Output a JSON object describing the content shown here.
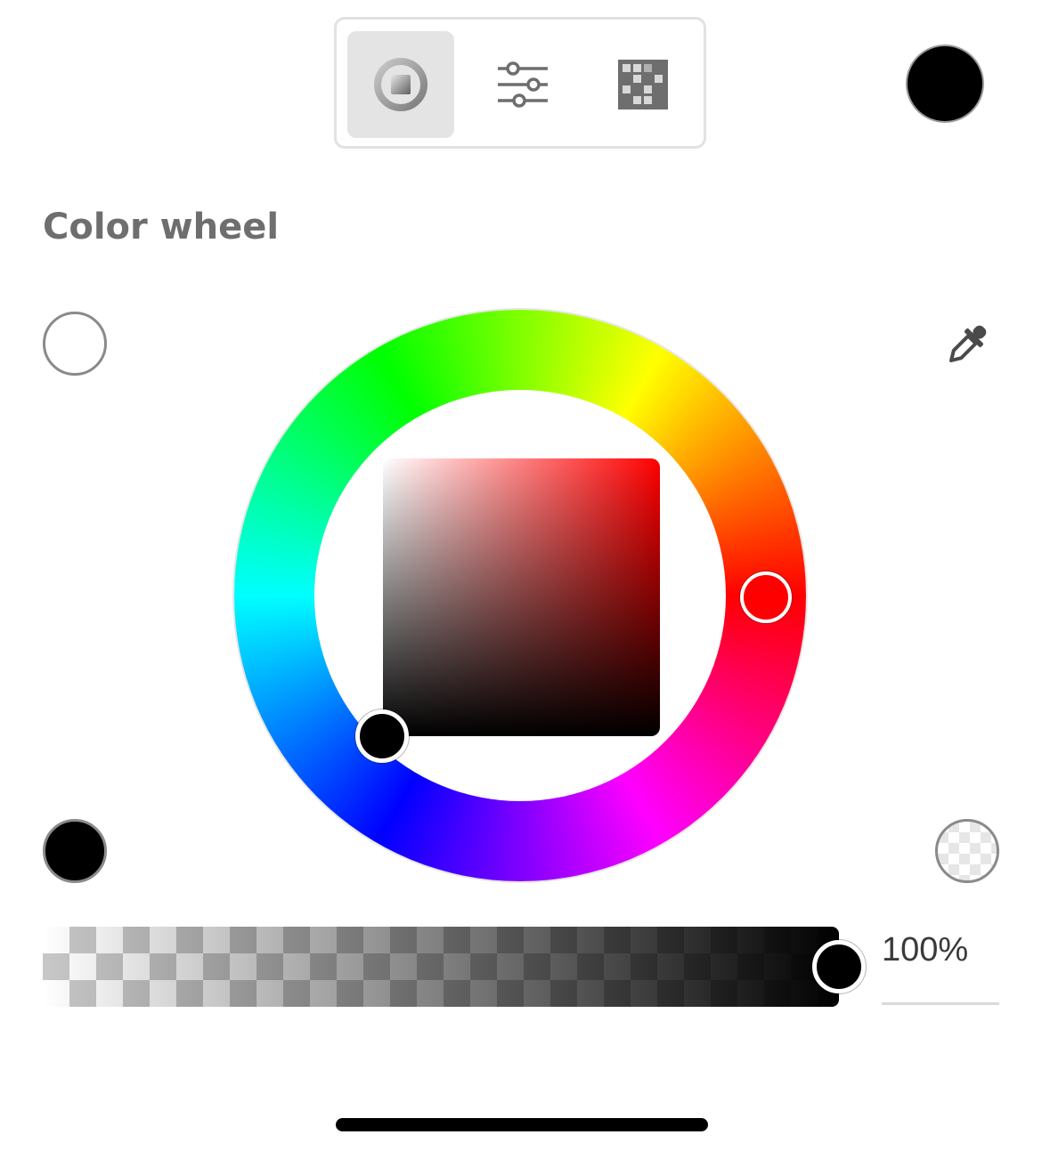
{
  "colors": {
    "current": "#000000",
    "hue": "#ff0000",
    "selected": "#000000",
    "recent_white": "#ffffff",
    "recent_black": "#000000"
  },
  "mode_tabs": [
    {
      "name": "color-wheel-mode",
      "icon": "color-wheel-icon",
      "selected": true
    },
    {
      "name": "sliders-mode",
      "icon": "sliders-icon",
      "selected": false
    },
    {
      "name": "swatches-mode",
      "icon": "swatches-grid-icon",
      "selected": false
    }
  ],
  "section_title": "Color wheel",
  "opacity": {
    "value_text": "100%",
    "value": 100
  },
  "icons": {
    "eyedropper": "eyedropper-icon"
  }
}
